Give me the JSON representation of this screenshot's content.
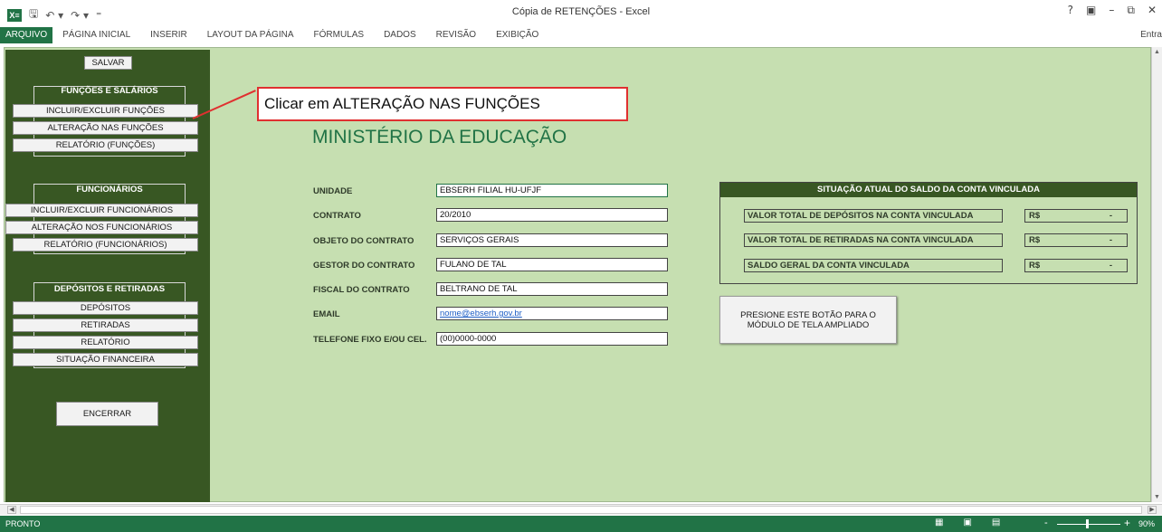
{
  "window": {
    "title": "Cópia de RETENÇÕES - Excel",
    "controls": [
      "?",
      "▣",
      "–",
      "⧉",
      "✕"
    ],
    "signin": "Entra"
  },
  "qat": {
    "logo": "X≡",
    "save": "🖫",
    "undo": "↶ ▾",
    "redo": "↷ ▾",
    "more": "⁼"
  },
  "ribbon": {
    "tabs": [
      "ARQUIVO",
      "PÁGINA INICIAL",
      "INSERIR",
      "LAYOUT DA PÁGINA",
      "FÓRMULAS",
      "DADOS",
      "REVISÃO",
      "EXIBIÇÃO"
    ]
  },
  "sidebar": {
    "save": "SALVAR",
    "groups": [
      {
        "title": "FUNÇÕES E SALÁRIOS",
        "items": [
          "INCLUIR/EXCLUIR FUNÇÕES",
          "ALTERAÇÃO NAS FUNÇÕES",
          "RELATÓRIO (FUNÇÕES)"
        ]
      },
      {
        "title": "FUNCIONÁRIOS",
        "items": [
          "INCLUIR/EXCLUIR FUNCIONÁRIOS",
          "ALTERAÇÃO NOS FUNCIONÁRIOS",
          "RELATÓRIO (FUNCIONÁRIOS)"
        ]
      },
      {
        "title": "DEPÓSITOS E RETIRADAS",
        "items": [
          "DEPÓSITOS",
          "RETIRADAS",
          "RELATÓRIO",
          "SITUAÇÃO FINANCEIRA"
        ]
      }
    ],
    "close": "ENCERRAR"
  },
  "callout": "Clicar em ALTERAÇÃO NAS FUNÇÕES",
  "heading": "MINISTÉRIO DA EDUCAÇÃO",
  "form": [
    {
      "label": "UNIDADE",
      "value": "EBSERH FILIAL HU-UFJF"
    },
    {
      "label": "CONTRATO",
      "value": "20/2010"
    },
    {
      "label": "OBJETO DO CONTRATO",
      "value": "SERVIÇOS GERAIS"
    },
    {
      "label": "GESTOR DO CONTRATO",
      "value": "FULANO DE TAL"
    },
    {
      "label": "FISCAL DO CONTRATO",
      "value": "BELTRANO DE TAL"
    },
    {
      "label": "EMAIL",
      "value": "nome@ebserh.gov.br"
    },
    {
      "label": "TELEFONE FIXO E/OU CEL.",
      "value": "(00)0000-0000"
    }
  ],
  "balance": {
    "title": "SITUAÇÃO ATUAL DO SALDO DA CONTA VINCULADA",
    "rows": [
      {
        "label": "VALOR TOTAL DE DEPÓSITOS NA CONTA VINCULADA",
        "currency": "R$",
        "value": "-"
      },
      {
        "label": "VALOR TOTAL DE RETIRADAS NA CONTA VINCULADA",
        "currency": "R$",
        "value": "-"
      },
      {
        "label": "SALDO GERAL DA CONTA VINCULADA",
        "currency": "R$",
        "value": "-"
      }
    ]
  },
  "expand_button": {
    "line1": "PRESIONE ESTE BOTÃO PARA O",
    "line2": "MÓDULO DE TELA AMPLIADO"
  },
  "status": {
    "ready": "PRONTO",
    "zoom_minus": "-",
    "zoom_plus": "+",
    "zoom": "90%"
  },
  "colors": {
    "excel_green": "#217346",
    "sheet_bg": "#c6dfb1",
    "sidebar_bg": "#385723",
    "callout_border": "#e03030"
  }
}
